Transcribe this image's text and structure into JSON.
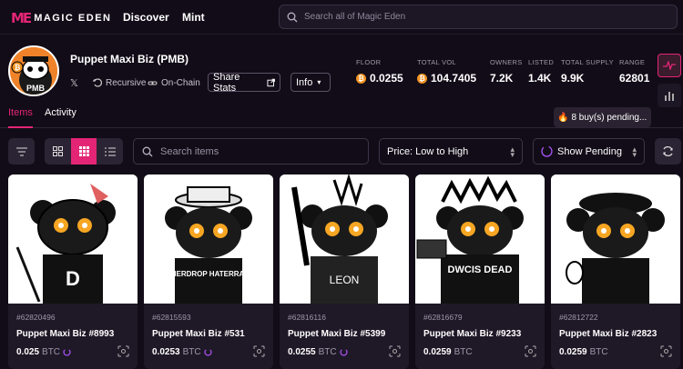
{
  "brand": {
    "name": "MAGIC EDEN",
    "accent": "#e42575"
  },
  "nav": {
    "discover": "Discover",
    "mint": "Mint"
  },
  "top_search": {
    "placeholder": "Search all of Magic Eden"
  },
  "collection": {
    "name": "Puppet Maxi Biz (PMB)",
    "avatar_text": "PMB",
    "tags": {
      "recursive": "Recursive",
      "onchain": "On-Chain"
    },
    "share_stats": "Share Stats",
    "info": "Info"
  },
  "stats": [
    {
      "label": "FLOOR",
      "value": "0.0255",
      "btc": true
    },
    {
      "label": "TOTAL VOL",
      "value": "104.7405",
      "btc": true
    },
    {
      "label": "OWNERS",
      "value": "7.2K",
      "btc": false
    },
    {
      "label": "LISTED",
      "value": "1.4K",
      "btc": false
    },
    {
      "label": "TOTAL SUPPLY",
      "value": "9.9K",
      "btc": false
    },
    {
      "label": "RANGE",
      "value": "62801",
      "btc": false
    }
  ],
  "tabs": {
    "items": "Items",
    "activity": "Activity"
  },
  "pending_badge": "8 buy(s) pending...",
  "toolbar": {
    "search_placeholder": "Search items",
    "sort": "Price: Low to High",
    "show_pending": "Show Pending"
  },
  "cards": [
    {
      "inscription": "#62820496",
      "name": "Puppet Maxi Biz #8993",
      "price": "0.025",
      "currency": "BTC"
    },
    {
      "inscription": "#62815593",
      "name": "Puppet Maxi Biz #531",
      "price": "0.0253",
      "currency": "BTC"
    },
    {
      "inscription": "#62816116",
      "name": "Puppet Maxi Biz #5399",
      "price": "0.0255",
      "currency": "BTC"
    },
    {
      "inscription": "#62816679",
      "name": "Puppet Maxi Biz #9233",
      "price": "0.0259",
      "currency": "BTC"
    },
    {
      "inscription": "#62812722",
      "name": "Puppet Maxi Biz #2823",
      "price": "0.0259",
      "currency": "BTC"
    }
  ],
  "card_art_text": {
    "c2": "RUMERDROP HATERRALLY",
    "c3": "LEON",
    "c4": "DWCIS DEAD"
  }
}
